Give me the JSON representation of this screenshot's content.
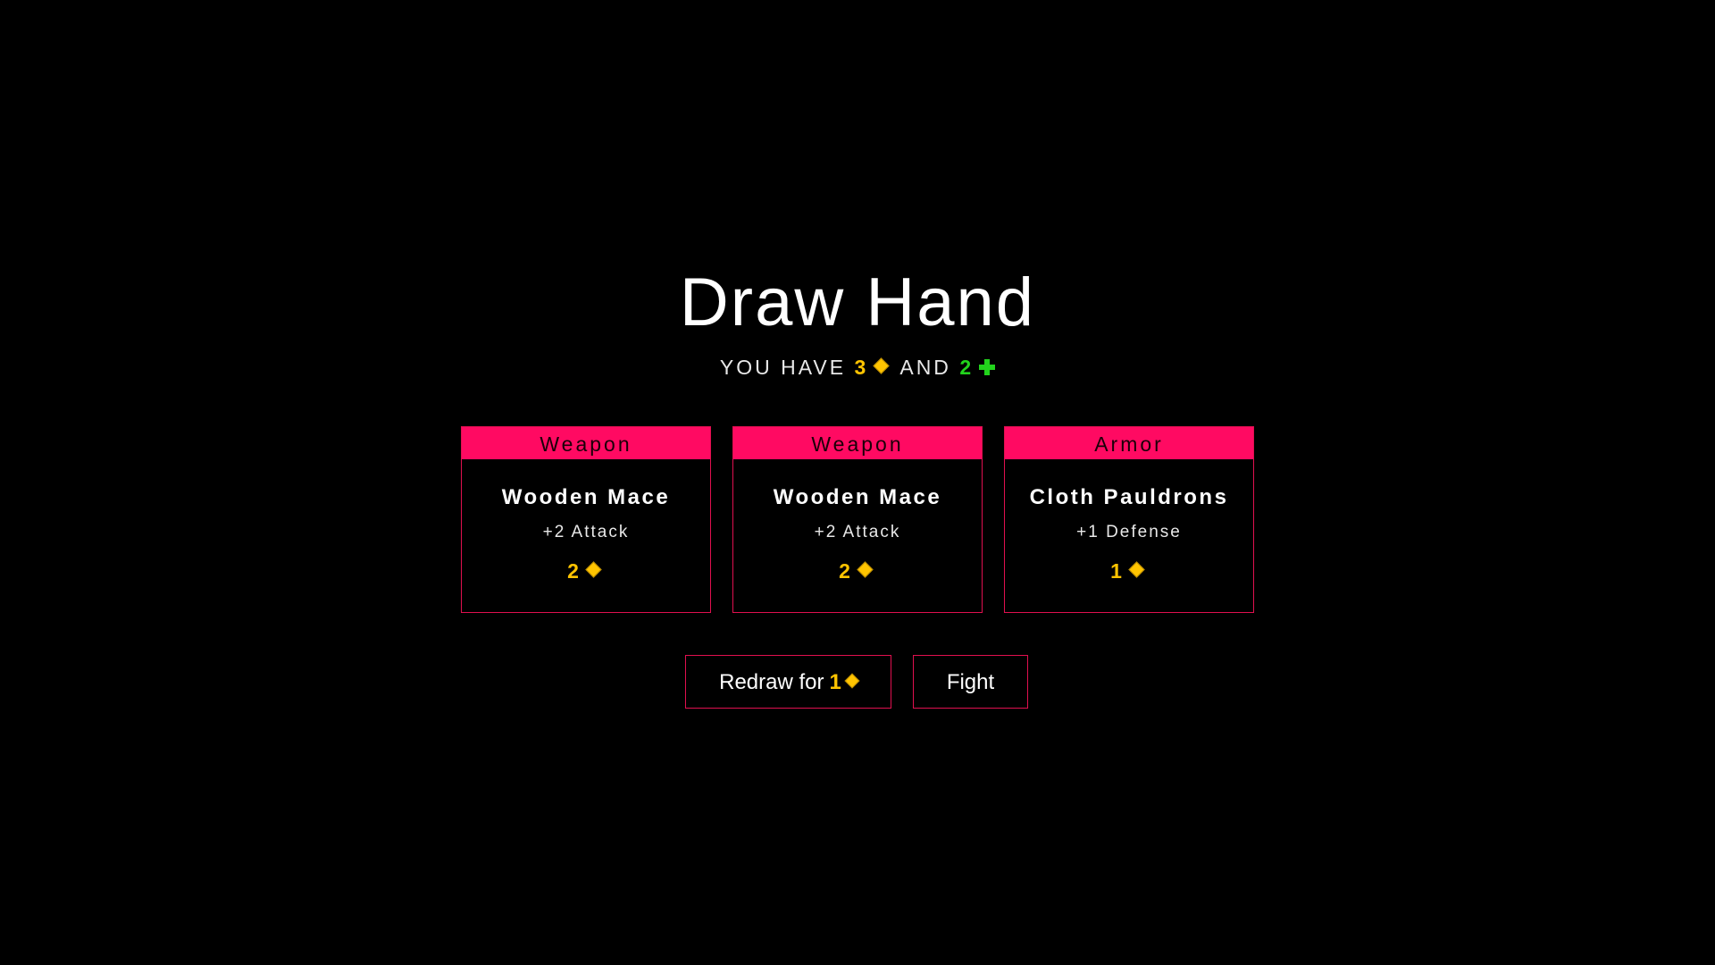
{
  "title": "Draw Hand",
  "resources": {
    "prefix": "YOU HAVE",
    "gold": "3",
    "conjunction": "AND",
    "health": "2"
  },
  "icons": {
    "gold": "gold-diamond-icon",
    "health": "green-plus-icon"
  },
  "colors": {
    "background": "#000000",
    "accent": "#ff0a62",
    "gold": "#ffc400",
    "health": "#22d31c"
  },
  "cards": [
    {
      "type": "Weapon",
      "name": "Wooden Mace",
      "effect": "+2 Attack",
      "cost": "2"
    },
    {
      "type": "Weapon",
      "name": "Wooden Mace",
      "effect": "+2 Attack",
      "cost": "2"
    },
    {
      "type": "Armor",
      "name": "Cloth Pauldrons",
      "effect": "+1 Defense",
      "cost": "1"
    }
  ],
  "buttons": {
    "redraw_label": "Redraw for",
    "redraw_cost": "1",
    "fight_label": "Fight"
  }
}
